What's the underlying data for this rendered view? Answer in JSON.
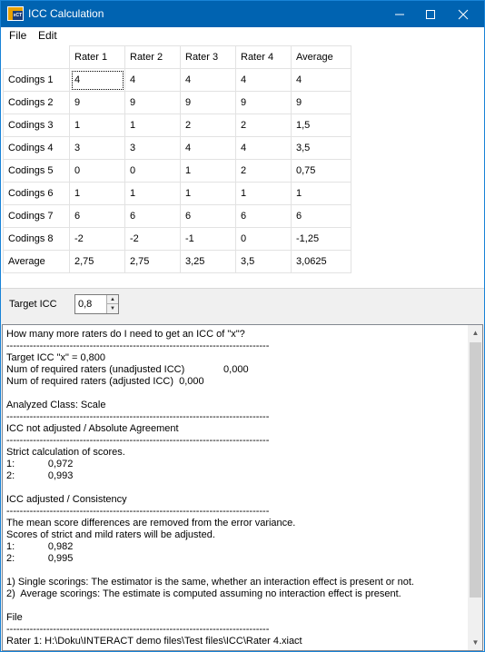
{
  "window": {
    "title": "ICC Calculation",
    "icon_text": "xCT",
    "controls": {
      "minimize": "—",
      "maximize": "☐",
      "close": "✕"
    }
  },
  "menu": {
    "file": "File",
    "edit": "Edit"
  },
  "grid": {
    "columns": [
      "Rater 1",
      "Rater 2",
      "Rater 3",
      "Rater 4",
      "Average"
    ],
    "rows": [
      {
        "label": "Codings 1",
        "cells": [
          "4",
          "4",
          "4",
          "4",
          "4"
        ]
      },
      {
        "label": "Codings 2",
        "cells": [
          "9",
          "9",
          "9",
          "9",
          "9"
        ]
      },
      {
        "label": "Codings 3",
        "cells": [
          "1",
          "1",
          "2",
          "2",
          "1,5"
        ]
      },
      {
        "label": "Codings 4",
        "cells": [
          "3",
          "3",
          "4",
          "4",
          "3,5"
        ]
      },
      {
        "label": "Codings 5",
        "cells": [
          "0",
          "0",
          "1",
          "2",
          "0,75"
        ]
      },
      {
        "label": "Codings 6",
        "cells": [
          "1",
          "1",
          "1",
          "1",
          "1"
        ]
      },
      {
        "label": "Codings 7",
        "cells": [
          "6",
          "6",
          "6",
          "6",
          "6"
        ]
      },
      {
        "label": "Codings 8",
        "cells": [
          "-2",
          "-2",
          "-1",
          "0",
          "-1,25"
        ]
      },
      {
        "label": "Average",
        "cells": [
          "2,75",
          "2,75",
          "3,25",
          "3,5",
          "3,0625"
        ]
      }
    ]
  },
  "target": {
    "label": "Target ICC",
    "value": "0,8"
  },
  "output": {
    "lines": [
      "How many more raters do I need to get an ICC of \"x\"?",
      "-------------------------------------------------------------------------------",
      "Target ICC \"x\" = 0,800",
      "Num of required raters (unadjusted ICC)              0,000",
      "Num of required raters (adjusted ICC)  0,000",
      "",
      "Analyzed Class: Scale",
      "-------------------------------------------------------------------------------",
      "ICC not adjusted / Absolute Agreement",
      "-------------------------------------------------------------------------------",
      "Strict calculation of scores.",
      "1:            0,972",
      "2:            0,993",
      "",
      "ICC adjusted / Consistency",
      "-------------------------------------------------------------------------------",
      "The mean score differences are removed from the error variance.",
      "Scores of strict and mild raters will be adjusted.",
      "1:            0,982",
      "2:            0,995",
      "",
      "1) Single scorings: The estimator is the same, whether an interaction effect is present or not.",
      "2)  Average scorings: The estimate is computed assuming no interaction effect is present.",
      "",
      "File",
      "-------------------------------------------------------------------------------",
      "Rater 1: H:\\Doku\\INTERACT demo files\\Test files\\ICC\\Rater 4.xiact"
    ]
  }
}
